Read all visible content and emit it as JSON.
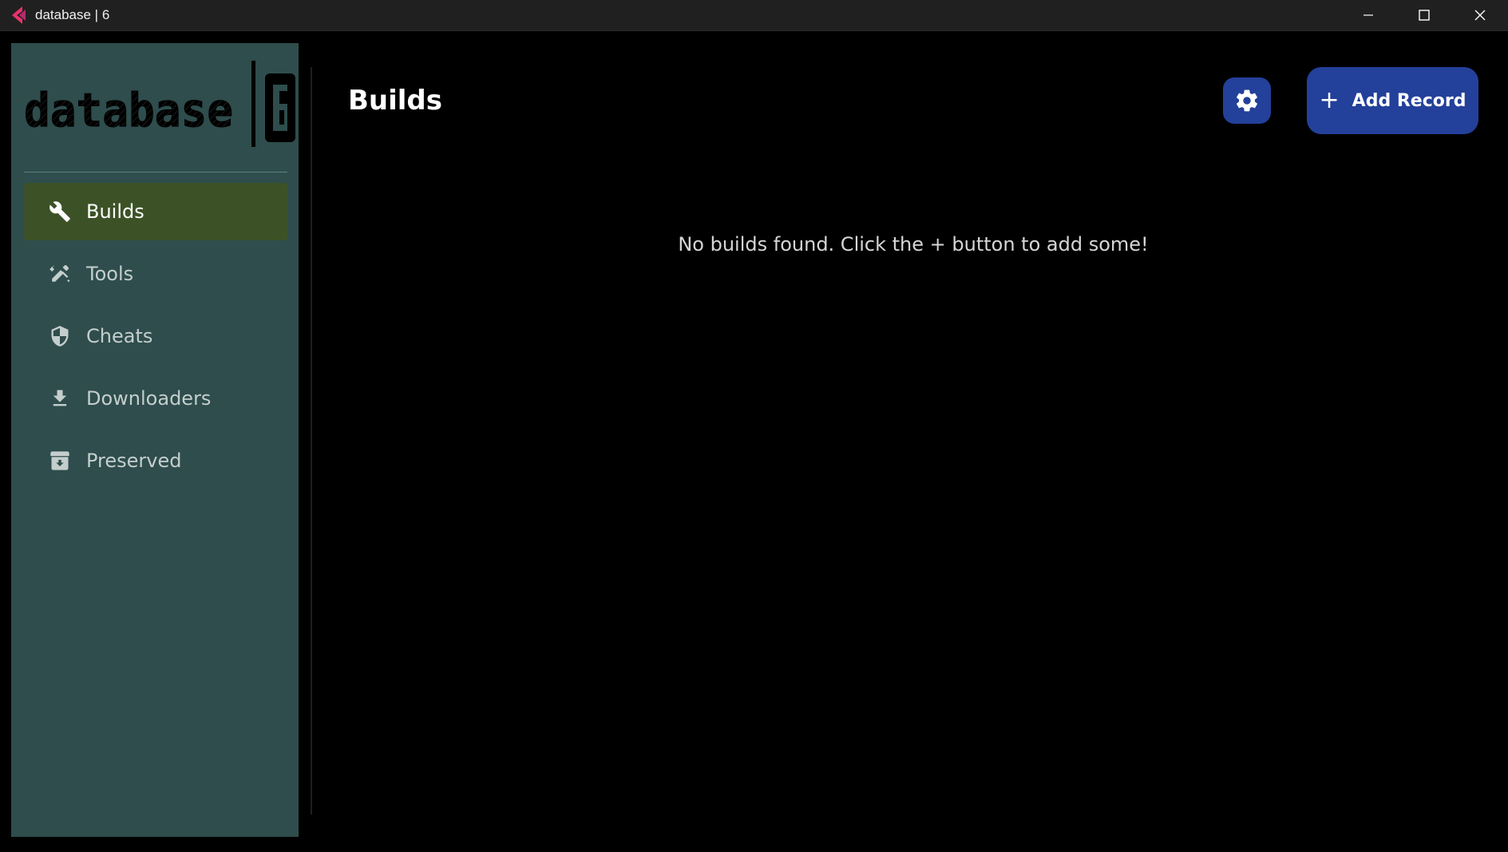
{
  "window": {
    "title": "database | 6",
    "app_icon": "app-chevron-icon",
    "controls": [
      "minimize-icon",
      "maximize-icon",
      "close-icon"
    ]
  },
  "sidebar": {
    "logo_text": "database | 6",
    "items": [
      {
        "label": "Builds",
        "icon": "wrench-icon",
        "active": true
      },
      {
        "label": "Tools",
        "icon": "tools-icon",
        "active": false
      },
      {
        "label": "Cheats",
        "icon": "shield-icon",
        "active": false
      },
      {
        "label": "Downloaders",
        "icon": "download-icon",
        "active": false
      },
      {
        "label": "Preserved",
        "icon": "archive-icon",
        "active": false
      }
    ]
  },
  "main": {
    "title": "Builds",
    "settings_icon": "gear-icon",
    "add_button_label": "Add Record",
    "empty_message": "No builds found. Click the + button to add some!"
  },
  "colors": {
    "sidebar_bg": "#2e4d4c",
    "active_item_bg": "#3c5226",
    "button_bg": "#23409a",
    "app_icon": "#e8336a"
  }
}
